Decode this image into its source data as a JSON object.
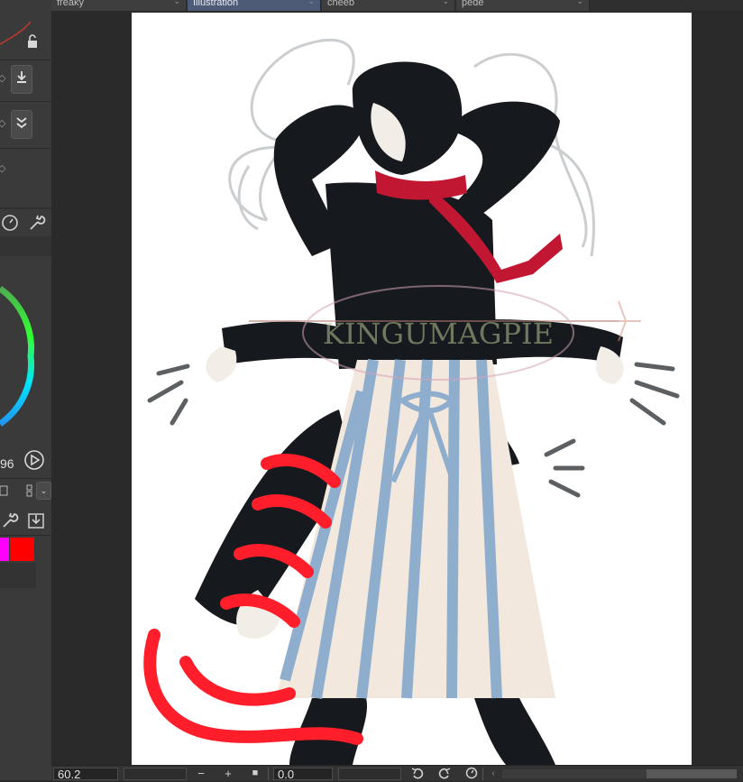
{
  "tabs": [
    {
      "label": "freaky",
      "active": false
    },
    {
      "label": "Illustration",
      "active": true
    },
    {
      "label": "cheeb",
      "active": false
    },
    {
      "label": "pede",
      "active": false
    }
  ],
  "left_panel": {
    "color_value_text": "96",
    "swatches": [
      "#ff00ff",
      "#ff0000"
    ],
    "brush_preview_color": "#c0392b"
  },
  "bottom_bar": {
    "zoom_value": "60.2",
    "zoom_out_glyph": "−",
    "zoom_in_glyph": "+",
    "fit_glyph": "■",
    "rotation_value": "0.0"
  },
  "watermark": {
    "text": "KINGUMAGPIE"
  },
  "colors": {
    "panel_bg": "#3a3a3a",
    "app_bg": "#2a2a2a",
    "active_tab": "#4d5b76",
    "canvas_bg": "#ffffff"
  }
}
